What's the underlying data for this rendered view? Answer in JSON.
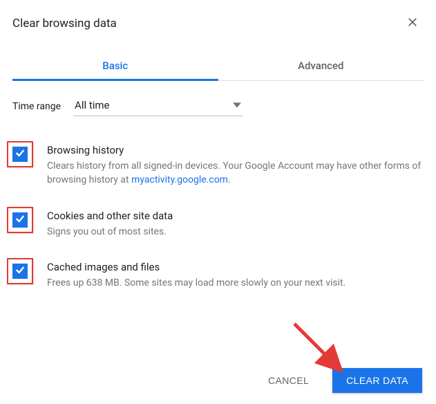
{
  "dialog": {
    "title": "Clear browsing data"
  },
  "tabs": {
    "basic": "Basic",
    "advanced": "Advanced"
  },
  "timerange": {
    "label": "Time range",
    "value": "All time"
  },
  "options": {
    "history": {
      "title": "Browsing history",
      "desc_prefix": "Clears history from all signed-in devices. Your Google Account may have other forms of browsing history at ",
      "link_text": "myactivity.google.com",
      "desc_suffix": "."
    },
    "cookies": {
      "title": "Cookies and other site data",
      "desc": "Signs you out of most sites."
    },
    "cache": {
      "title": "Cached images and files",
      "desc": "Frees up 638 MB. Some sites may load more slowly on your next visit."
    }
  },
  "buttons": {
    "cancel": "Cancel",
    "clear": "Clear data"
  }
}
